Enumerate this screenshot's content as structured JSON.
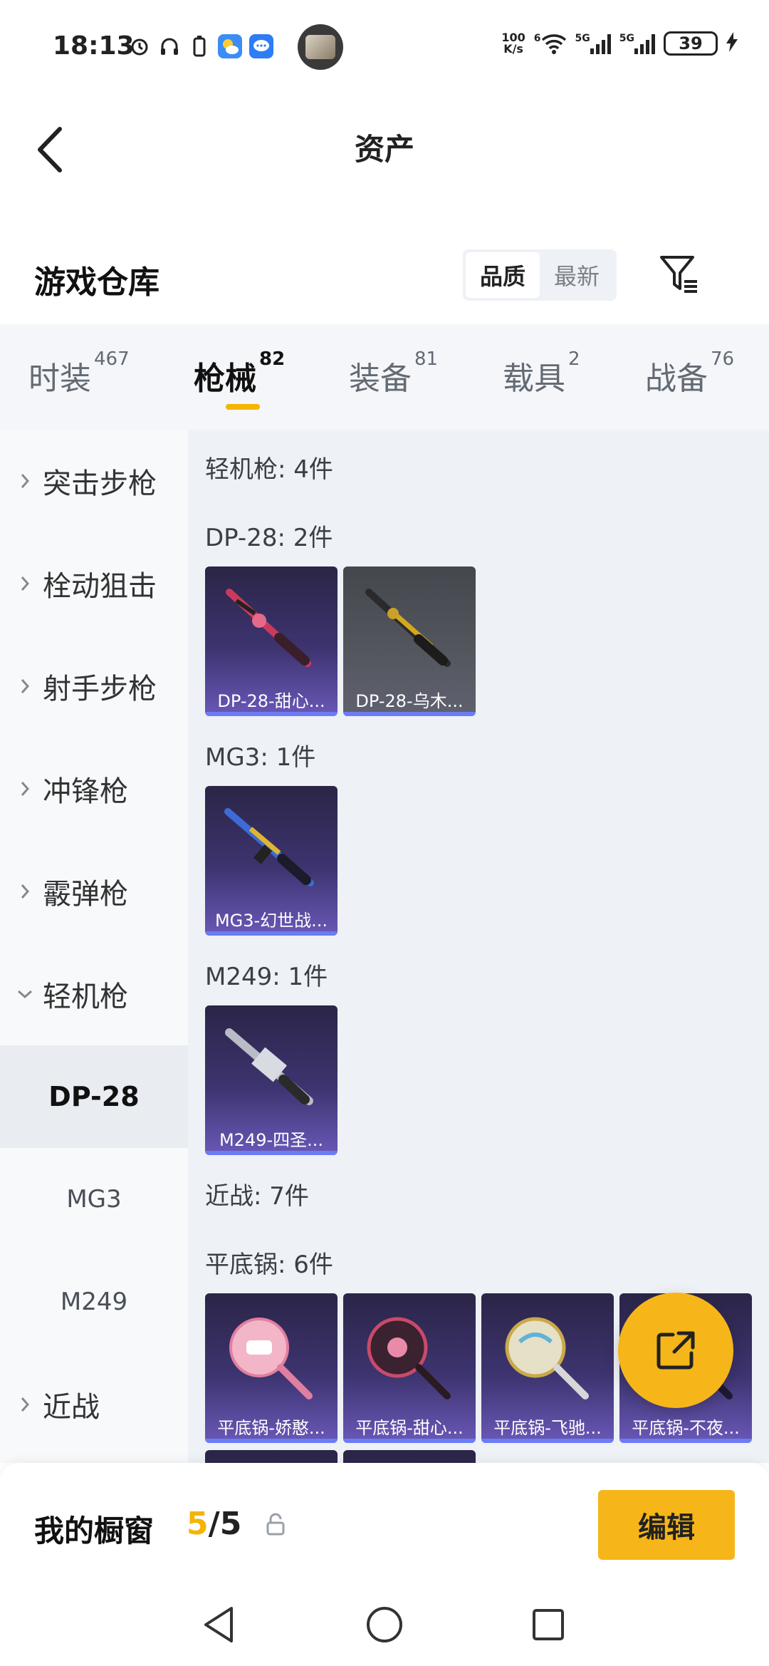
{
  "status_bar": {
    "time": "18:13",
    "net_speed_top": "100",
    "net_speed_bottom": "K/s",
    "battery": "39",
    "signal_label_1": "5G",
    "signal_label_2": "5G",
    "wifi_label": "6"
  },
  "header": {
    "title": "资产"
  },
  "section": {
    "title": "游戏仓库",
    "sort_options": [
      "品质",
      "最新"
    ]
  },
  "tabs": [
    {
      "label": "时装",
      "count": "467"
    },
    {
      "label": "枪械",
      "count": "82"
    },
    {
      "label": "装备",
      "count": "81"
    },
    {
      "label": "载具",
      "count": "2"
    },
    {
      "label": "战备",
      "count": "76"
    }
  ],
  "sidebar": {
    "items": [
      {
        "label": "突击步枪"
      },
      {
        "label": "栓动狙击"
      },
      {
        "label": "射手步枪"
      },
      {
        "label": "冲锋枪"
      },
      {
        "label": "霰弹枪"
      },
      {
        "label": "轻机枪"
      }
    ],
    "sub_items": [
      {
        "label": "DP-28"
      },
      {
        "label": "MG3"
      },
      {
        "label": "M249"
      }
    ],
    "melee": {
      "label": "近战"
    }
  },
  "content": {
    "lmg_header": "轻机枪: 4件",
    "dp28_header": "DP-28: 2件",
    "dp28_items": [
      "DP-28-甜心...",
      "DP-28-乌木..."
    ],
    "mg3_header": "MG3: 1件",
    "mg3_items": [
      "MG3-幻世战..."
    ],
    "m249_header": "M249: 1件",
    "m249_items": [
      "M249-四圣..."
    ],
    "melee_header": "近战: 7件",
    "pan_header": "平底锅: 6件",
    "pan_items": [
      "平底锅-娇憨...",
      "平底锅-甜心...",
      "平底锅-飞驰...",
      "平底锅-不夜..."
    ]
  },
  "window_bar": {
    "title": "我的橱窗",
    "current": "5",
    "separator": "/",
    "total": "5",
    "edit_label": "编辑"
  },
  "colors": {
    "accent": "#f6b61a",
    "card_purple": "#3d3470",
    "card_gray": "#55575f"
  }
}
